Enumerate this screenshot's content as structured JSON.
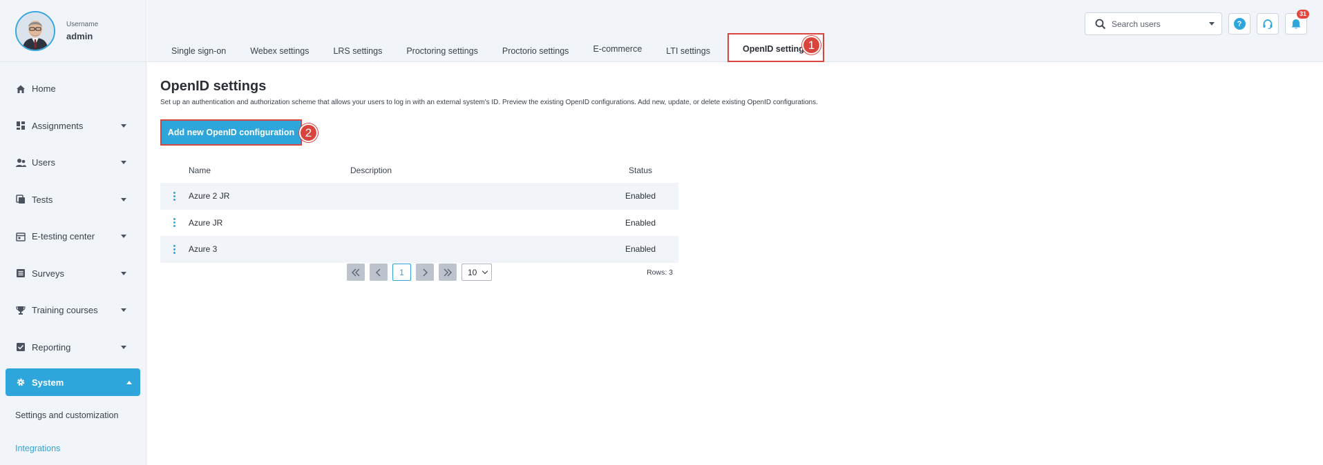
{
  "profile": {
    "label": "Username",
    "name": "admin"
  },
  "sidebar": {
    "items": [
      {
        "label": "Home",
        "icon": "home-icon",
        "has_chevron": false
      },
      {
        "label": "Assignments",
        "icon": "dashboard-icon",
        "has_chevron": true
      },
      {
        "label": "Users",
        "icon": "users-icon",
        "has_chevron": true
      },
      {
        "label": "Tests",
        "icon": "tests-icon",
        "has_chevron": true
      },
      {
        "label": "E-testing center",
        "icon": "calendar-icon",
        "has_chevron": true
      },
      {
        "label": "Surveys",
        "icon": "list-icon",
        "has_chevron": true
      },
      {
        "label": "Training courses",
        "icon": "trophy-icon",
        "has_chevron": true
      },
      {
        "label": "Reporting",
        "icon": "report-icon",
        "has_chevron": true
      }
    ],
    "active": {
      "label": "System",
      "icon": "gear-icon"
    },
    "subitems": [
      {
        "label": "Settings and customization"
      },
      {
        "label": "Integrations"
      }
    ]
  },
  "header": {
    "search_placeholder": "Search users",
    "help_label": "?",
    "notification_count": "31",
    "accent": "#2ea6dc",
    "highlight": "#d9453d"
  },
  "tabs": [
    {
      "label": "Single sign-on"
    },
    {
      "label": "Webex settings"
    },
    {
      "label": "LRS settings"
    },
    {
      "label": "Proctoring settings"
    },
    {
      "label": "Proctorio settings"
    },
    {
      "label": "E-commerce"
    },
    {
      "label": "LTI settings"
    },
    {
      "label": "OpenID settings"
    }
  ],
  "markers": [
    "1",
    "2"
  ],
  "main": {
    "title": "OpenID settings",
    "description": "Set up an authentication and authorization scheme that allows your users to log in with an external system's ID. Preview the existing OpenID configurations. Add new, update, or delete existing OpenID configurations.",
    "add_button": "Add new OpenID configuration"
  },
  "table": {
    "columns": [
      "Name",
      "Description",
      "Status"
    ],
    "rows": [
      {
        "name": "Azure 2 JR",
        "description": "",
        "status": "Enabled"
      },
      {
        "name": "Azure JR",
        "description": "",
        "status": "Enabled"
      },
      {
        "name": "Azure 3",
        "description": "",
        "status": "Enabled"
      }
    ]
  },
  "pager": {
    "current_page": "1",
    "page_size": "10",
    "rows_label": "Rows: 3"
  }
}
